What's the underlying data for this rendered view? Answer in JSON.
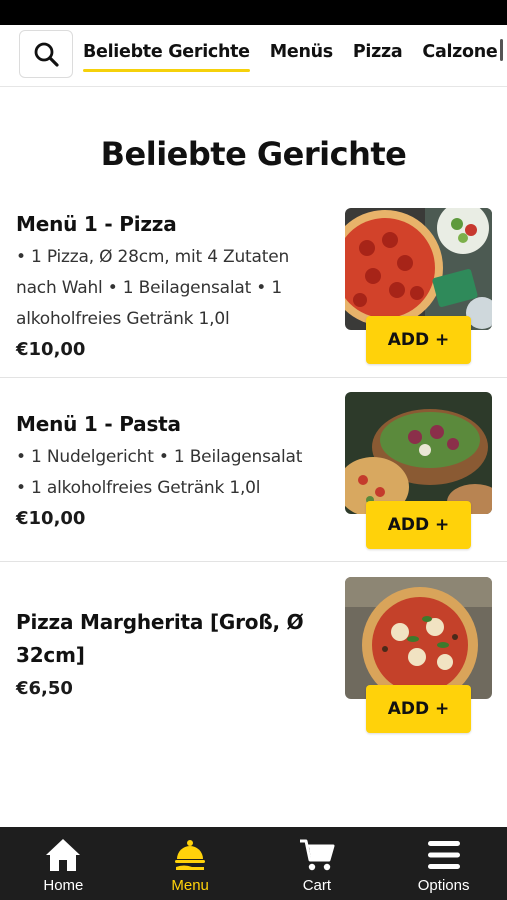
{
  "categories": [
    {
      "label": "Beliebte Gerichte",
      "active": true
    },
    {
      "label": "Menüs",
      "active": false
    },
    {
      "label": "Pizza",
      "active": false
    },
    {
      "label": "Calzone",
      "active": false
    }
  ],
  "section": {
    "title": "Beliebte Gerichte"
  },
  "items": [
    {
      "name": "Menü 1 - Pizza",
      "description_lines": [
        "• 1 Pizza, Ø 28cm, mit 4 Zutaten",
        "nach Wahl • 1 Beilagensalat • 1",
        "alkoholfreies Getränk 1,0l"
      ],
      "price": "€10,00",
      "add_label": "ADD +"
    },
    {
      "name": "Menü 1 - Pasta",
      "description_lines": [
        "• 1 Nudelgericht • 1 Beilagensalat",
        "• 1 alkoholfreies Getränk 1,0l"
      ],
      "price": "€10,00",
      "add_label": "ADD +"
    },
    {
      "name_lines": [
        "Pizza Margherita [Groß, Ø",
        "32cm]"
      ],
      "price": "€6,50",
      "add_label": "ADD +"
    }
  ],
  "bottom_nav": [
    {
      "label": "Home",
      "icon": "home-icon",
      "active": false
    },
    {
      "label": "Menu",
      "icon": "serving-cloche-icon",
      "active": true
    },
    {
      "label": "Cart",
      "icon": "cart-icon",
      "active": false
    },
    {
      "label": "Options",
      "icon": "hamburger-menu-icon",
      "active": false
    }
  ],
  "colors": {
    "accent": "#ffd20a",
    "nav_bg": "#1e1e1e",
    "status_bar": "#000000"
  }
}
